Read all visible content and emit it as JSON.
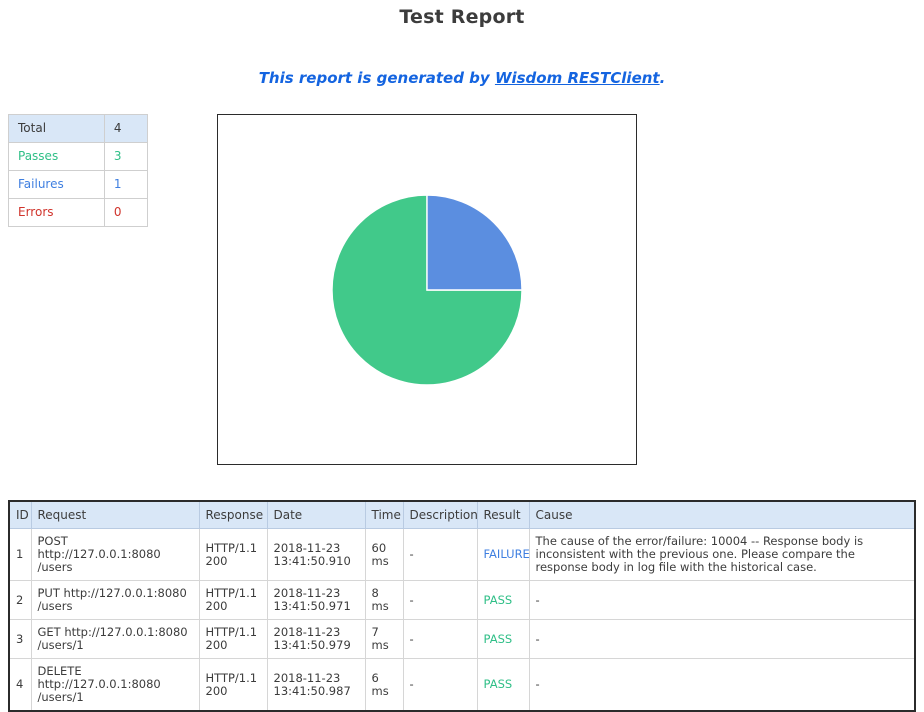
{
  "page": {
    "title": "Test Report",
    "subtitle_prefix": "This report is generated by ",
    "subtitle_link": "Wisdom RESTClient",
    "subtitle_suffix": "."
  },
  "colors": {
    "pass_green": "#2fbf87",
    "failure_blue": "#3f7fe0",
    "error_red": "#d0342c",
    "header_blue": "#d9e7f7",
    "link_blue": "#1464e0",
    "pie_green": "#41c98a",
    "pie_blue": "#5b8ee0"
  },
  "summary": {
    "rows": [
      {
        "label": "Total",
        "value": "4"
      },
      {
        "label": "Passes",
        "value": "3"
      },
      {
        "label": "Failures",
        "value": "1"
      },
      {
        "label": "Errors",
        "value": "0"
      }
    ]
  },
  "chart_data": {
    "type": "pie",
    "title": "",
    "categories": [
      "Passes",
      "Failures"
    ],
    "values": [
      3,
      1
    ],
    "percentages": [
      75,
      25
    ],
    "colors": [
      "#41c98a",
      "#5b8ee0"
    ],
    "start_angle_deg": 0,
    "direction": "counterclockwise",
    "legend": "none",
    "slice_border": "#ffffff"
  },
  "detail": {
    "columns": [
      "ID",
      "Request",
      "Response",
      "Date",
      "Time",
      "Description",
      "Result",
      "Cause"
    ],
    "rows": [
      {
        "id": "1",
        "request": "POST http://127.0.0.1:8080\n/users",
        "response": "HTTP/1.1\n200",
        "date": "2018-11-23\n13:41:50.910",
        "time": "60\nms",
        "description": "-",
        "result": "FAILURE",
        "result_class": "failure",
        "cause": "The cause of the error/failure: 10004 -- Response body is inconsistent with the previous one. Please compare the response body in log file with the historical case."
      },
      {
        "id": "2",
        "request": "PUT http://127.0.0.1:8080\n/users",
        "response": "HTTP/1.1\n200",
        "date": "2018-11-23\n13:41:50.971",
        "time": "8 ms",
        "description": "-",
        "result": "PASS",
        "result_class": "pass",
        "cause": "-"
      },
      {
        "id": "3",
        "request": "GET http://127.0.0.1:8080\n/users/1",
        "response": "HTTP/1.1\n200",
        "date": "2018-11-23\n13:41:50.979",
        "time": "7 ms",
        "description": "-",
        "result": "PASS",
        "result_class": "pass",
        "cause": "-"
      },
      {
        "id": "4",
        "request": "DELETE\nhttp://127.0.0.1:8080\n/users/1",
        "response": "HTTP/1.1\n200",
        "date": "2018-11-23\n13:41:50.987",
        "time": "6 ms",
        "description": "-",
        "result": "PASS",
        "result_class": "pass",
        "cause": "-"
      }
    ]
  }
}
